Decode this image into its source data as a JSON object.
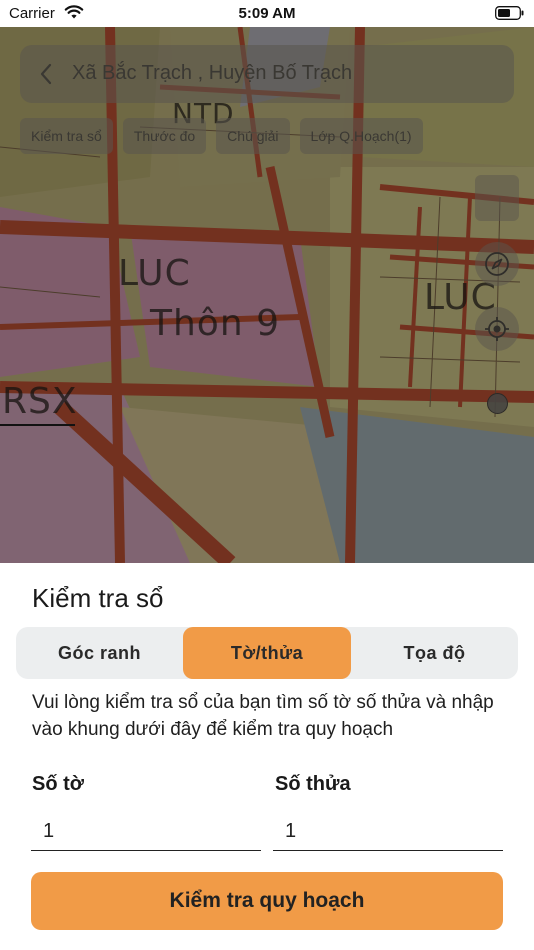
{
  "status_bar": {
    "carrier": "Carrier",
    "time": "5:09 AM"
  },
  "map": {
    "location_title": "Xã Bắc Trạch , Huyện Bố Trạch",
    "chips": [
      "Kiểm tra sổ",
      "Thước đo",
      "Chú giải",
      "Lớp Q.Hoạch(1)"
    ],
    "labels": [
      "LUC",
      "Thôn 9",
      "LUC",
      "RSX",
      "NTD"
    ],
    "icons": {
      "back": "chevron-left-icon",
      "compass": "compass-icon",
      "locate": "crosshair-icon",
      "layers": "layers-icon"
    }
  },
  "sheet": {
    "title": "Kiểm tra sổ",
    "tabs": [
      {
        "label": "Góc ranh",
        "active": false
      },
      {
        "label": "Tờ/thửa",
        "active": true
      },
      {
        "label": "Tọa độ",
        "active": false
      }
    ],
    "description": "Vui lòng kiểm tra sổ của bạn tìm số tờ số thửa và nhập vào khung dưới đây để kiểm tra quy hoạch",
    "fields": {
      "so_to": {
        "label": "Số tờ",
        "value": "1"
      },
      "so_thua": {
        "label": "Số thửa",
        "value": "1"
      }
    },
    "submit_label": "Kiểm tra quy hoạch"
  },
  "colors": {
    "accent": "#f19b47",
    "segment_bg": "#eceeef"
  }
}
